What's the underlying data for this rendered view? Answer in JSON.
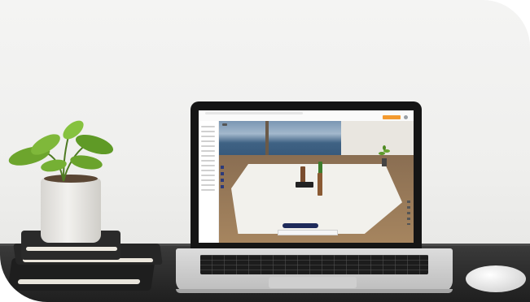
{
  "app": {
    "brand": "",
    "breadcrumb": "",
    "cta_label": ""
  },
  "colors": {
    "cta": "#f39a2f",
    "toolbar": "#1e2a5a",
    "wall": "#f4f4f3",
    "desk": "#2a2a2a"
  },
  "icons": [
    "plant-icon",
    "laptop-icon",
    "mouse-icon"
  ]
}
